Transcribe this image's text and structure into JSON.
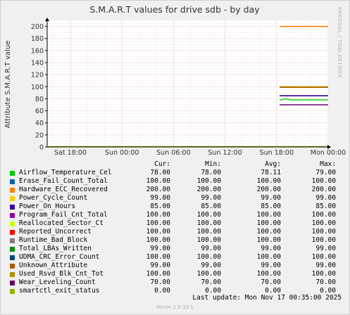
{
  "chart_data": {
    "type": "line",
    "title": "S.M.A.R.T values for drive sdb - by day",
    "ylabel": "Attribute S.M.A.R.T value",
    "ylim": [
      0,
      210
    ],
    "yticks": [
      0,
      20,
      40,
      60,
      80,
      100,
      120,
      140,
      160,
      180,
      200
    ],
    "x_ticks": [
      "Sat 18:00",
      "Sun 00:00",
      "Sun 06:00",
      "Sun 12:00",
      "Sun 18:00",
      "Mon 00:00"
    ],
    "grid": true,
    "series": [
      {
        "name": "Airflow_Temperature_Cel",
        "color": "#00cc00",
        "cur": "78.00",
        "min": "78.00",
        "avg": "78.11",
        "max": "79.00",
        "value": 78
      },
      {
        "name": "Erase_Fail_Count_Total",
        "color": "#0066b3",
        "cur": "100.00",
        "min": "100.00",
        "avg": "100.00",
        "max": "100.00",
        "value": 100
      },
      {
        "name": "Hardware_ECC_Recovered",
        "color": "#ff8000",
        "cur": "200.00",
        "min": "200.00",
        "avg": "200.00",
        "max": "200.00",
        "value": 200
      },
      {
        "name": "Power_Cycle_Count",
        "color": "#ffcc00",
        "cur": "99.00",
        "min": "99.00",
        "avg": "99.00",
        "max": "99.00",
        "value": 99
      },
      {
        "name": "Power_On_Hours",
        "color": "#330099",
        "cur": "85.00",
        "min": "85.00",
        "avg": "85.00",
        "max": "85.00",
        "value": 85
      },
      {
        "name": "Program_Fail_Cnt_Total",
        "color": "#990099",
        "cur": "100.00",
        "min": "100.00",
        "avg": "100.00",
        "max": "100.00",
        "value": 100
      },
      {
        "name": "Reallocated_Sector_Ct",
        "color": "#ccff00",
        "cur": "100.00",
        "min": "100.00",
        "avg": "100.00",
        "max": "100.00",
        "value": 100
      },
      {
        "name": "Reported_Uncorrect",
        "color": "#ff0000",
        "cur": "100.00",
        "min": "100.00",
        "avg": "100.00",
        "max": "100.00",
        "value": 100
      },
      {
        "name": "Runtime_Bad_Block",
        "color": "#808080",
        "cur": "100.00",
        "min": "100.00",
        "avg": "100.00",
        "max": "100.00",
        "value": 100
      },
      {
        "name": "Total_LBAs_Written",
        "color": "#008f00",
        "cur": "99.00",
        "min": "99.00",
        "avg": "99.00",
        "max": "99.00",
        "value": 99
      },
      {
        "name": "UDMA_CRC_Error_Count",
        "color": "#00487d",
        "cur": "100.00",
        "min": "100.00",
        "avg": "100.00",
        "max": "100.00",
        "value": 100
      },
      {
        "name": "Unknown_Attribute",
        "color": "#b35a00",
        "cur": "99.00",
        "min": "99.00",
        "avg": "99.00",
        "max": "99.00",
        "value": 99
      },
      {
        "name": "Used_Rsvd_Blk_Cnt_Tot",
        "color": "#b38f00",
        "cur": "100.00",
        "min": "100.00",
        "avg": "100.00",
        "max": "100.00",
        "value": 100
      },
      {
        "name": "Wear_Leveling_Count",
        "color": "#6b006b",
        "cur": "70.00",
        "min": "70.00",
        "avg": "70.00",
        "max": "70.00",
        "value": 70
      },
      {
        "name": "smartctl_exit_status",
        "color": "#8fb300",
        "cur": "0.00",
        "min": "0.00",
        "avg": "0.00",
        "max": "0.00",
        "value": 0
      }
    ]
  },
  "legend_headers": {
    "cur": "Cur:",
    "min": "Min:",
    "avg": "Avg:",
    "max": "Max:"
  },
  "last_update": "Last update:  Mon Nov 17 00:35:00 2025",
  "footer": "Munin 2.0.33-1",
  "side_text": "RRDTOOL / TOBI OETIKER"
}
